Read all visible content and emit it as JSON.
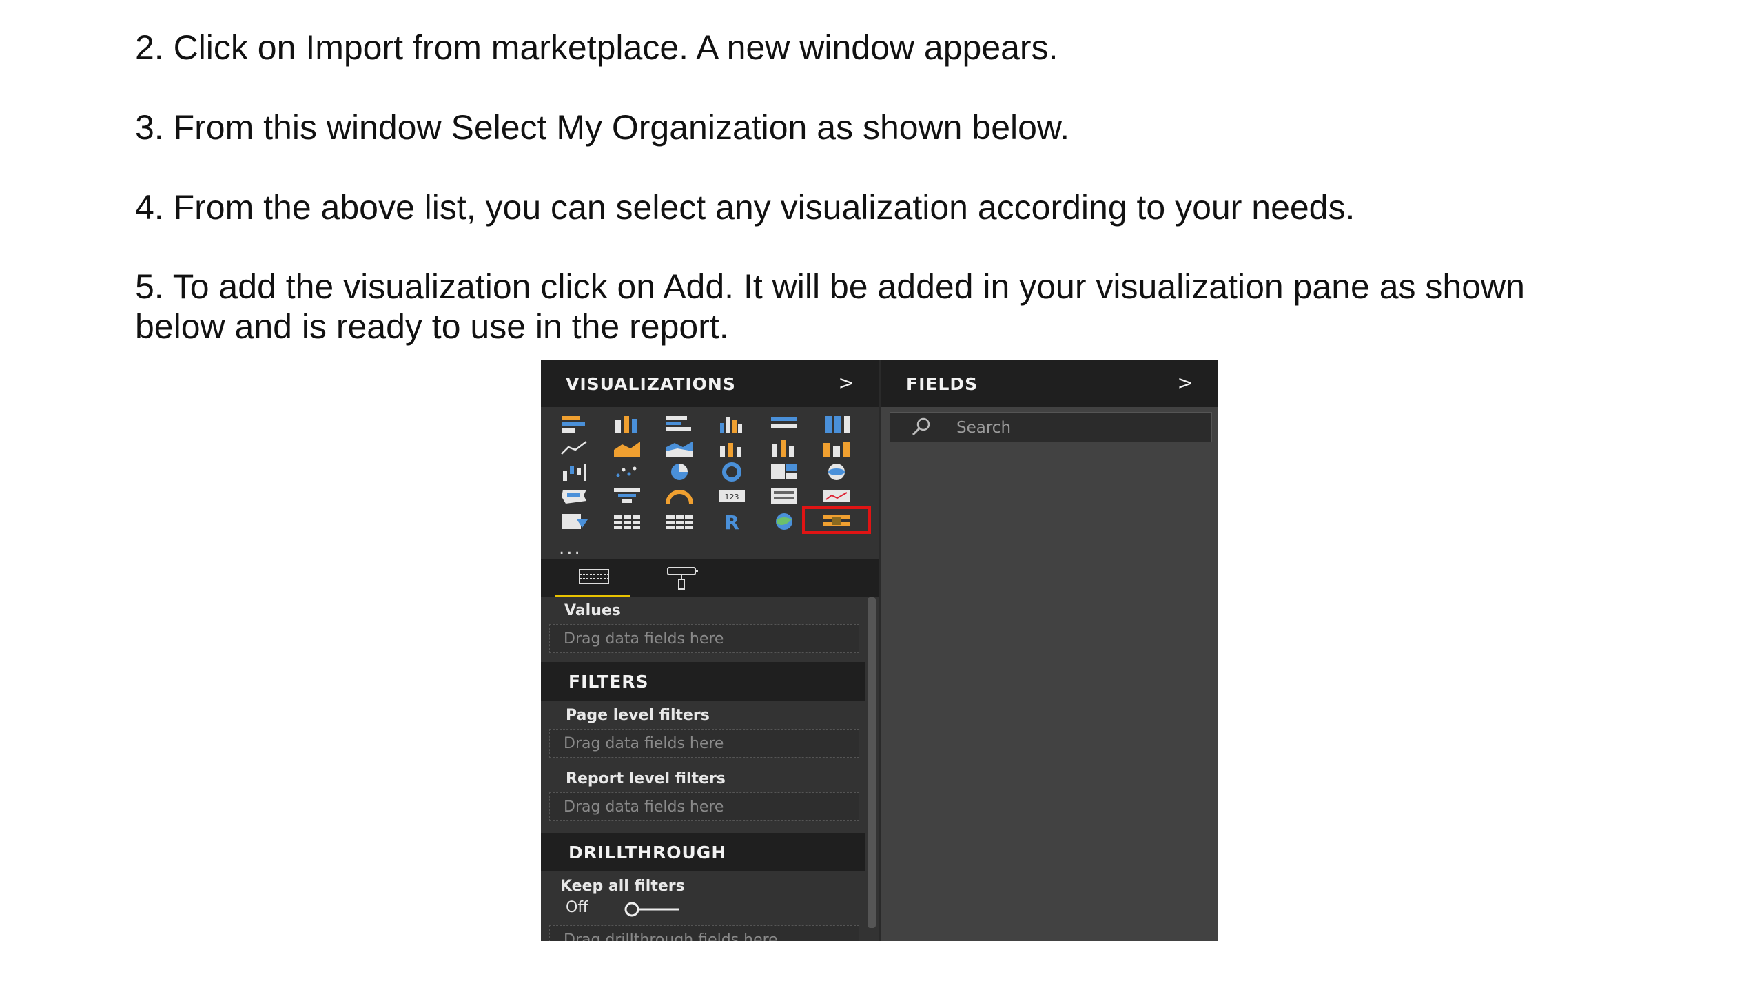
{
  "instructions": {
    "step2": "2. Click on Import from marketplace. A new window appears.",
    "step3": "3. From this window Select My Organization as shown below.",
    "step4": "4. From the above list, you can select any visualization according to your needs.",
    "step5_line1": "5. To add the visualization click on Add. It will be added in your visualization pane as shown",
    "step5_line2": "below and is ready to use in the report."
  },
  "visualizations_pane": {
    "title": "VISUALIZATIONS",
    "expand_glyph": ">",
    "more_glyph": "...",
    "values_label": "Values",
    "values_well": "Drag data fields here"
  },
  "fields_pane": {
    "title": "FIELDS",
    "expand_glyph": ">",
    "search_placeholder": "Search"
  },
  "filters": {
    "title": "FILTERS",
    "page_level_label": "Page level filters",
    "page_level_well": "Drag data fields here",
    "report_level_label": "Report level filters",
    "report_level_well": "Drag data fields here"
  },
  "drillthrough": {
    "title": "DRILLTHROUGH",
    "keep_filters_label": "Keep all filters",
    "toggle_state": "Off",
    "well": "Drag drillthrough fields here"
  },
  "colors": {
    "accent_yellow": "#e8c200",
    "icon_blue": "#4a90d9",
    "icon_orange": "#f0a030",
    "highlight_red": "#e01414"
  }
}
